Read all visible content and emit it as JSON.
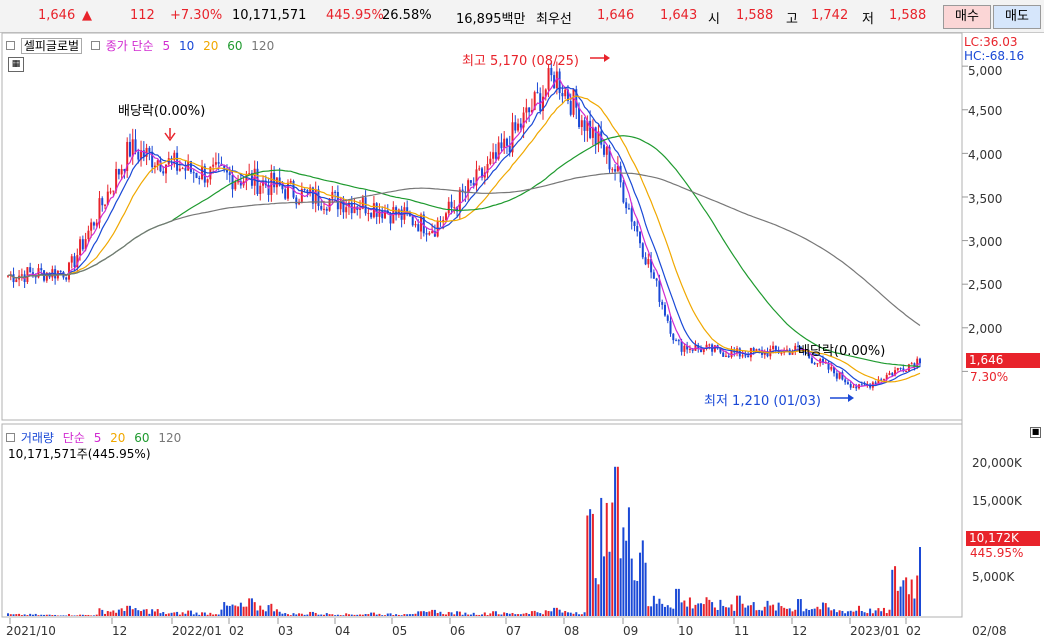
{
  "quote": {
    "price": "1,646",
    "change": "112",
    "change_pct": "+7.30%",
    "volume": "10,171,571",
    "volume_ratio": "445.95%",
    "turnover_rate": "26.58%",
    "amount": "16,895백만",
    "best_label": "최우선",
    "best_ask": "1,646",
    "best_bid": "1,643",
    "open_label": "시",
    "open": "1,588",
    "high_label": "고",
    "high": "1,742",
    "low_label": "저",
    "low": "1,588",
    "buy_label": "매수",
    "sell_label": "매도"
  },
  "price_panel": {
    "legend_check": "셀피글로벌",
    "legend_type": "종가 단순",
    "ma_periods": [
      "5",
      "10",
      "20",
      "60",
      "120"
    ],
    "lc": "LC:36.03",
    "hc": "HC:-68.16",
    "current_price_tag": "1,646",
    "current_pct_tag": "7.30%",
    "annotations": {
      "high": "최고 5,170 (08/25)",
      "low": "최저 1,210 (01/03)",
      "dividend1": "배당락(0.00%)",
      "dividend2": "배당락(0.00%)"
    },
    "y_labels": [
      "5,000",
      "4,500",
      "4,000",
      "3,500",
      "3,000",
      "2,500",
      "2,000"
    ]
  },
  "volume_panel": {
    "legend_title": "거래량",
    "legend_type": "단순",
    "ma_periods": [
      "5",
      "20",
      "60",
      "120"
    ],
    "info": "10,171,571주(445.95%)",
    "current_tag": "10,172K",
    "current_pct_tag": "445.95%",
    "y_labels": [
      "20,000K",
      "15,000K",
      "5,000K"
    ]
  },
  "x_labels": [
    "2021/10",
    "12",
    "2022/01",
    "02",
    "03",
    "04",
    "05",
    "06",
    "07",
    "08",
    "09",
    "10",
    "11",
    "12",
    "2023/01",
    "02",
    "02/08"
  ],
  "colors": {
    "up": "#e8232b",
    "down": "#1a49d6",
    "ma5": "#d12bd1",
    "ma10": "#1a49d6",
    "ma20": "#f0a800",
    "ma60": "#1e9a2e",
    "ma120": "#777777"
  },
  "chart_data": {
    "type": "line",
    "title": "",
    "x": [
      "2021/10",
      "12",
      "2022/01",
      "02",
      "03",
      "04",
      "05",
      "06",
      "07",
      "08",
      "09",
      "10",
      "11",
      "12",
      "2023/01",
      "02"
    ],
    "series": [
      {
        "name": "종가",
        "values": [
          2600,
          2650,
          4050,
          3800,
          3700,
          3500,
          3400,
          3150,
          3900,
          4900,
          3800,
          1800,
          1700,
          1750,
          1300,
          1646
        ]
      },
      {
        "name": "거래량",
        "values": [
          400,
          300,
          1500,
          800,
          2600,
          600,
          500,
          900,
          700,
          1200,
          22000,
          4000,
          3000,
          2500,
          1500,
          10172
        ]
      }
    ],
    "ylim": [
      1000,
      5300
    ]
  }
}
